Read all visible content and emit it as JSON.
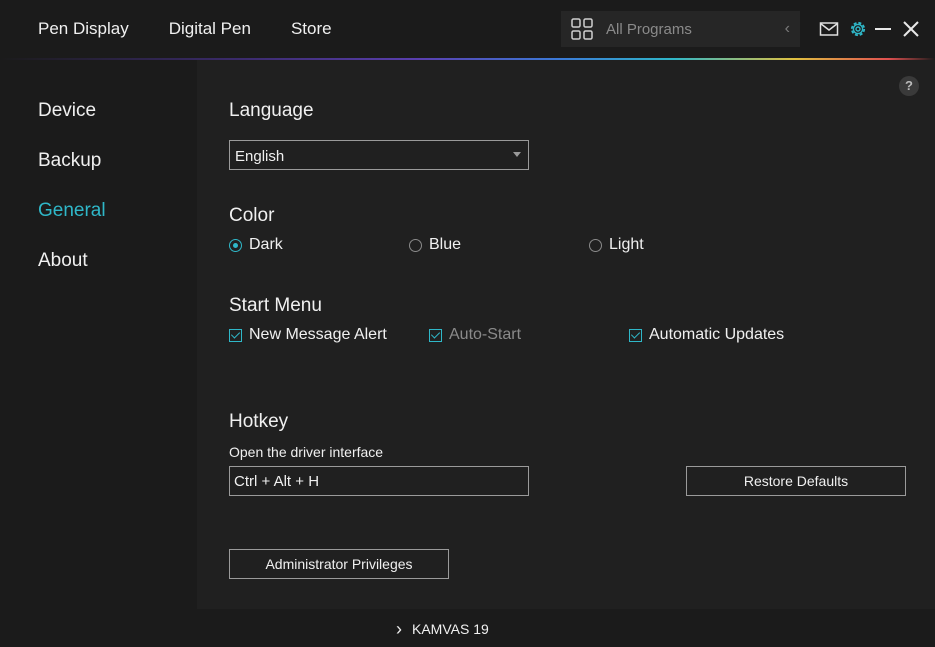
{
  "topnav": {
    "items": [
      "Pen Display",
      "Digital Pen",
      "Store"
    ]
  },
  "programs": {
    "label": "All Programs",
    "icon": "grid-icon",
    "chevron": "‹"
  },
  "window_controls": {
    "icons": [
      "mail-icon",
      "gear-icon",
      "minimize-icon",
      "close-icon"
    ],
    "accent": "#2fb7c8"
  },
  "sidebar": {
    "items": [
      {
        "label": "Device",
        "active": false
      },
      {
        "label": "Backup",
        "active": false
      },
      {
        "label": "General",
        "active": true
      },
      {
        "label": "About",
        "active": false
      }
    ]
  },
  "help": {
    "label": "?"
  },
  "language": {
    "title": "Language",
    "selected": "English"
  },
  "color": {
    "title": "Color",
    "options": [
      {
        "label": "Dark",
        "selected": true
      },
      {
        "label": "Blue",
        "selected": false
      },
      {
        "label": "Light",
        "selected": false
      }
    ]
  },
  "start_menu": {
    "title": "Start Menu",
    "options": [
      {
        "label": "New Message Alert",
        "checked": true,
        "enabled": true
      },
      {
        "label": "Auto-Start",
        "checked": true,
        "enabled": false
      },
      {
        "label": "Automatic Updates",
        "checked": true,
        "enabled": true
      }
    ]
  },
  "hotkey": {
    "title": "Hotkey",
    "label": "Open the driver interface",
    "value": "Ctrl + Alt + H"
  },
  "buttons": {
    "restore": "Restore Defaults",
    "admin": "Administrator Privileges"
  },
  "footer": {
    "device": "KAMVAS 19",
    "chevron": "›"
  },
  "colors": {
    "background": "#202020",
    "panel": "#1b1b1b",
    "accent": "#2fb7c8",
    "text": "#f0f0f0",
    "muted": "#8a8a8a"
  }
}
